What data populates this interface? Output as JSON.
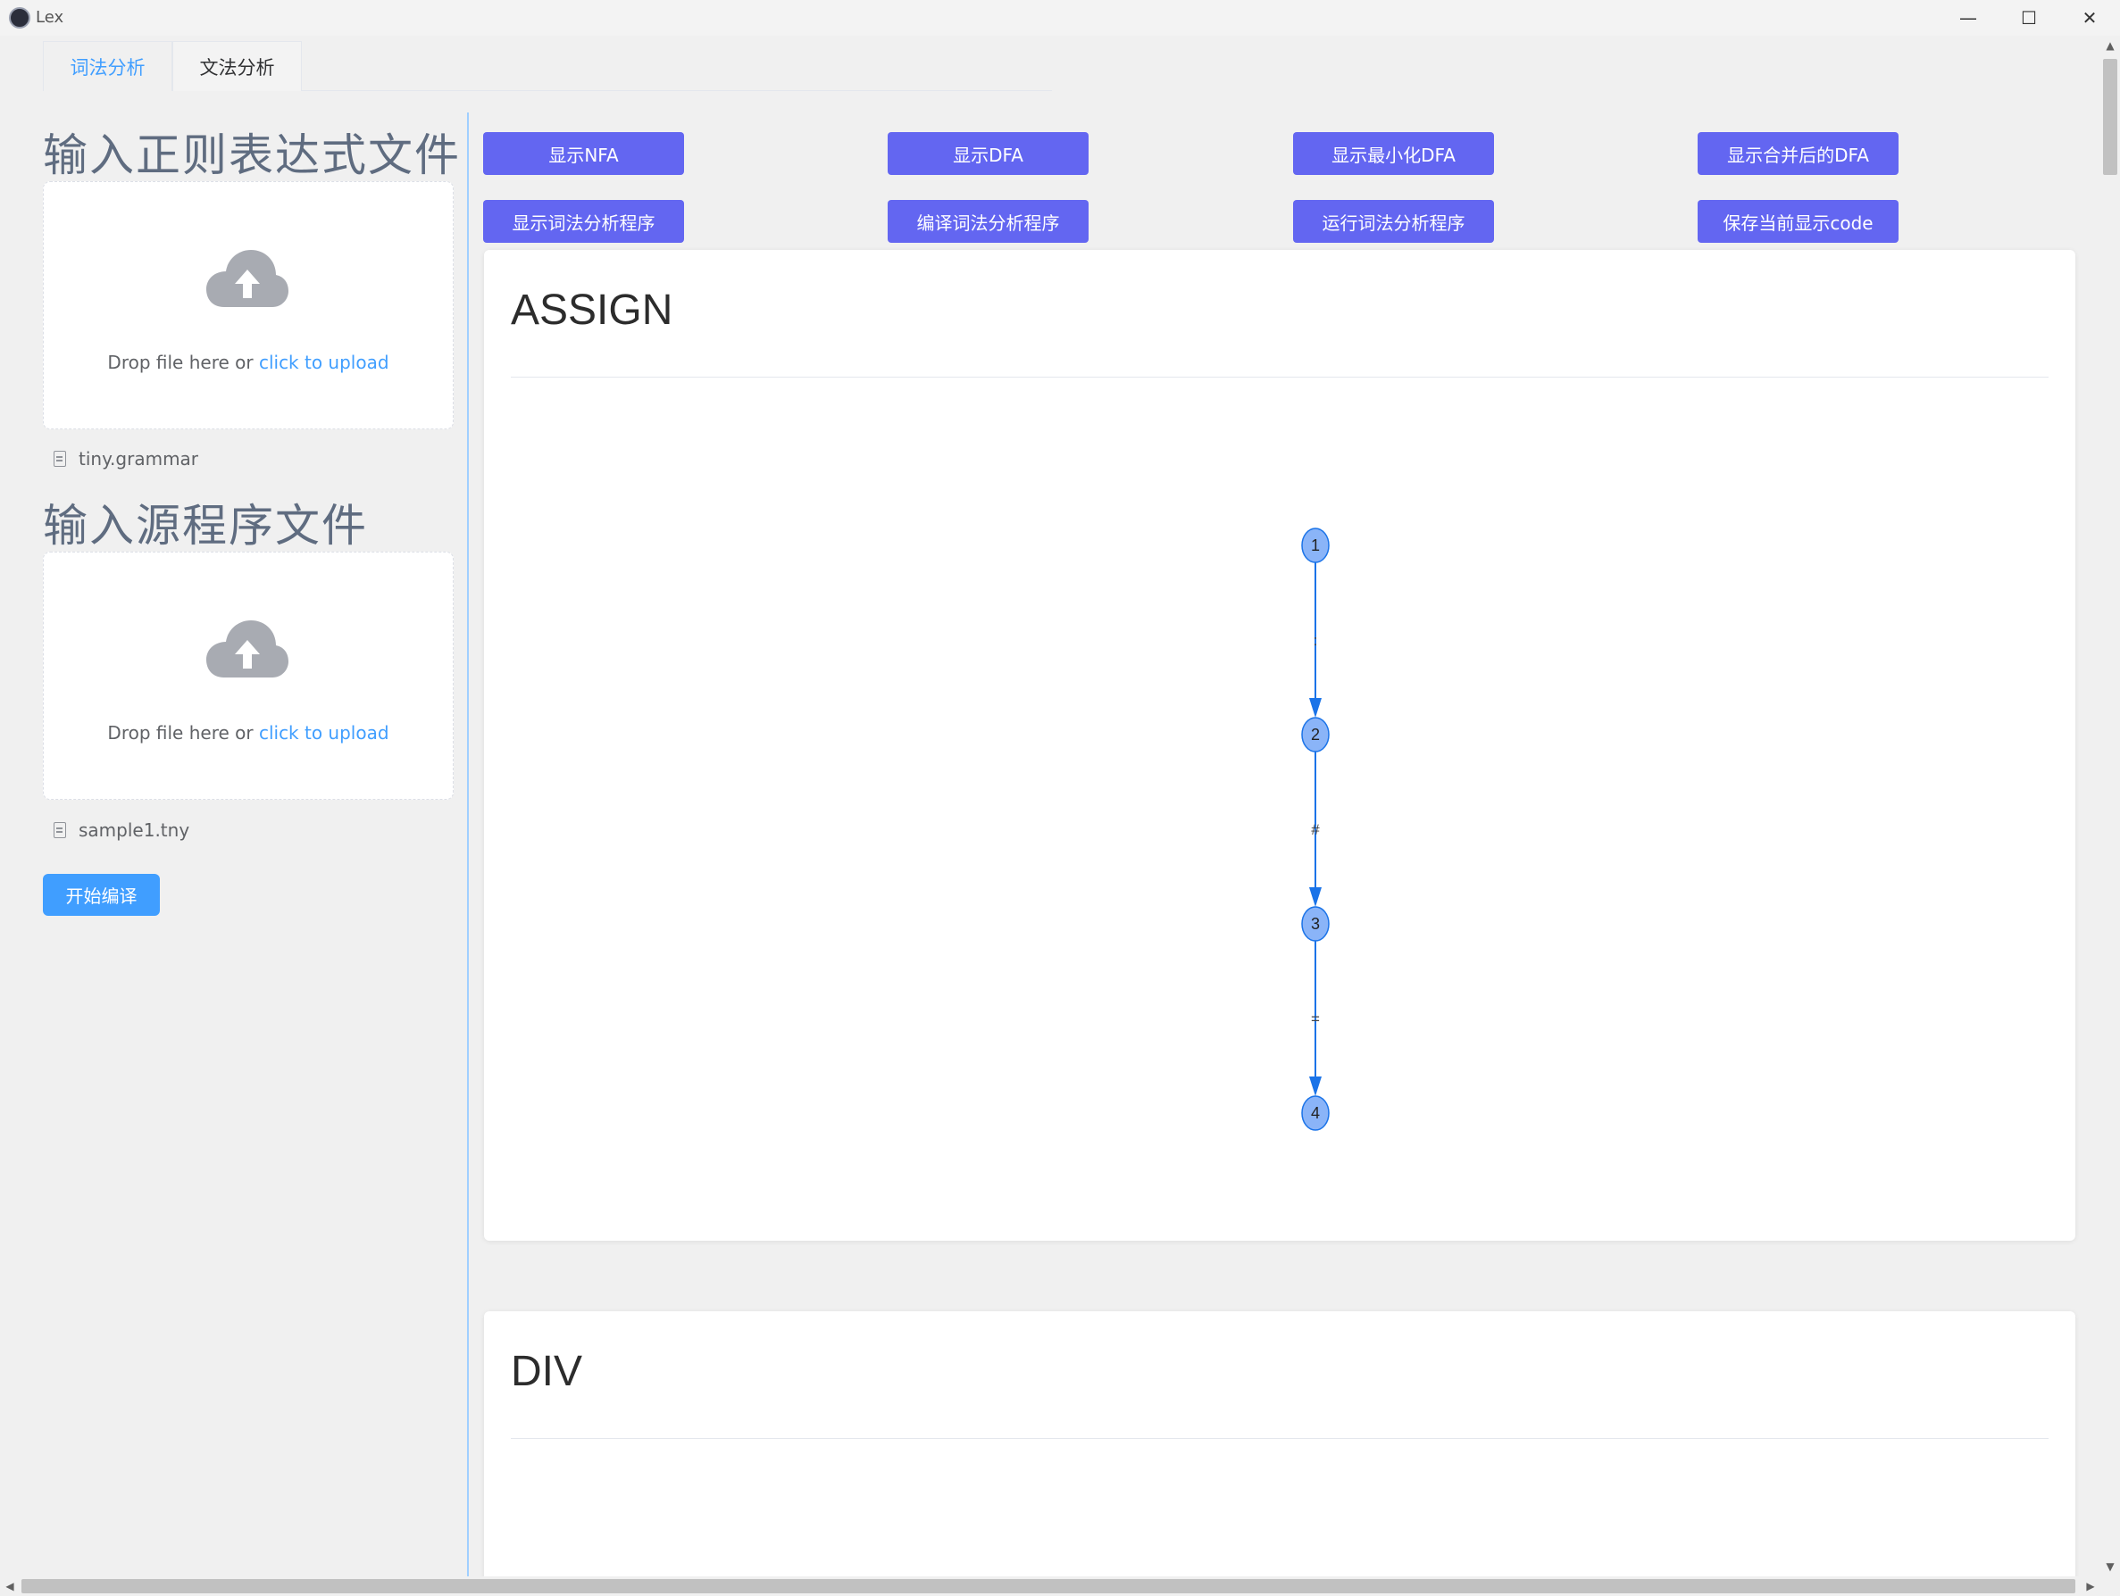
{
  "window": {
    "title": "Lex",
    "minimize_glyph": "—",
    "maximize_glyph": "☐",
    "close_glyph": "✕"
  },
  "tabs": [
    {
      "label": "词法分析",
      "active": true
    },
    {
      "label": "文法分析",
      "active": false
    }
  ],
  "regex_section": {
    "title": "输入正则表达式文件",
    "upload_text": "Drop file here or ",
    "upload_link": "click to upload",
    "file_name": "tiny.grammar"
  },
  "source_section": {
    "title": "输入源程序文件",
    "upload_text": "Drop file here or ",
    "upload_link": "click to upload",
    "file_name": "sample1.tny"
  },
  "compile_button": "开始编译",
  "actions": {
    "row1": [
      "显示NFA",
      "显示DFA",
      "显示最小化DFA",
      "显示合并后的DFA"
    ],
    "row2": [
      "显示词法分析程序",
      "编译词法分析程序",
      "运行词法分析程序",
      "保存当前显示code"
    ]
  },
  "cards": [
    {
      "title": "ASSIGN",
      "graph": {
        "nodes": [
          "1",
          "2",
          "3",
          "4"
        ],
        "edges": [
          {
            "from": "1",
            "to": "2",
            "label": ":"
          },
          {
            "from": "2",
            "to": "3",
            "label": "#"
          },
          {
            "from": "3",
            "to": "4",
            "label": "="
          }
        ]
      }
    },
    {
      "title": "DIV"
    }
  ],
  "colors": {
    "accent": "#409eff",
    "action_button": "#6366f1",
    "node_fill": "#8ab4f8",
    "edge": "#1a73e8"
  }
}
